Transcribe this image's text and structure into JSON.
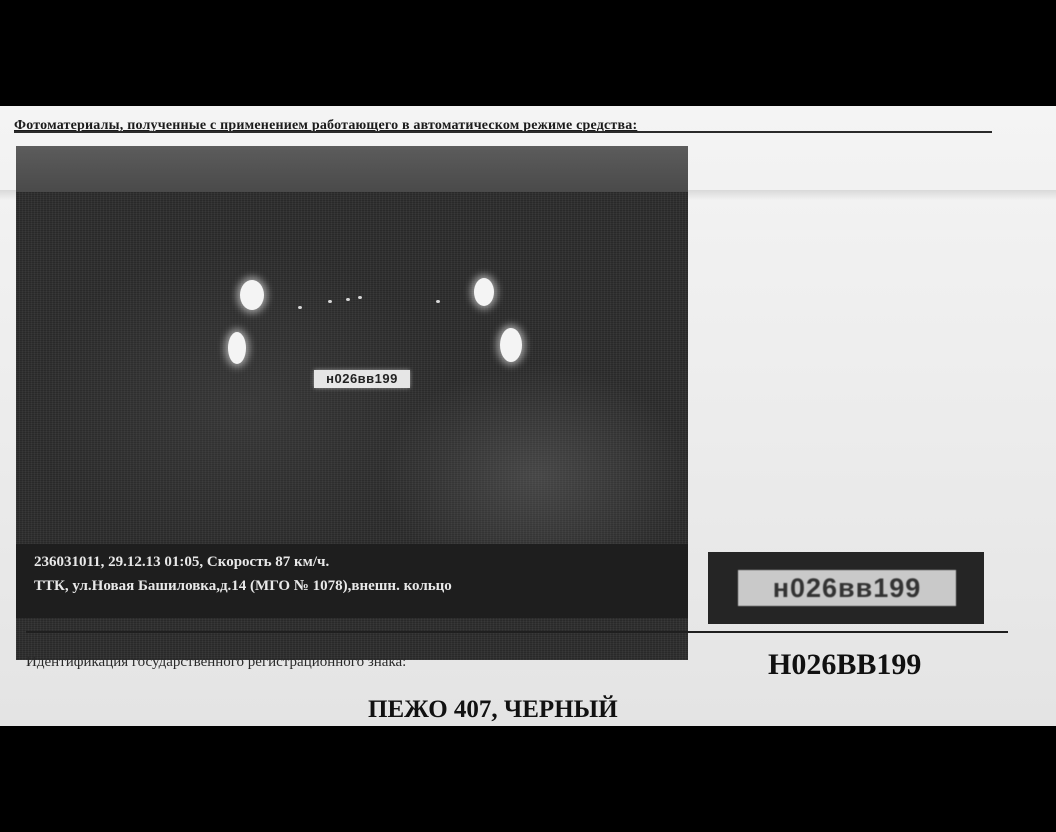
{
  "document": {
    "header": "Фотоматериалы, полученные с применением работающего в автоматическом режиме средства:",
    "photo": {
      "plate_in_photo": "Н026ВВ199",
      "caption_line1": "236031011, 29.12.13 01:05, Скорость 87 км/ч.",
      "caption_line2": "ТТК, ул.Новая Башиловка,д.14 (МГО № 1078),внешн. кольцо"
    },
    "plate_crop": "Н026ВВ199",
    "identification_label": "Идентификация государственного регистрационного знака:",
    "identification_value": "Н026ВВ199",
    "vehicle": "ПЕЖО 407, ЧЕРНЫЙ"
  }
}
